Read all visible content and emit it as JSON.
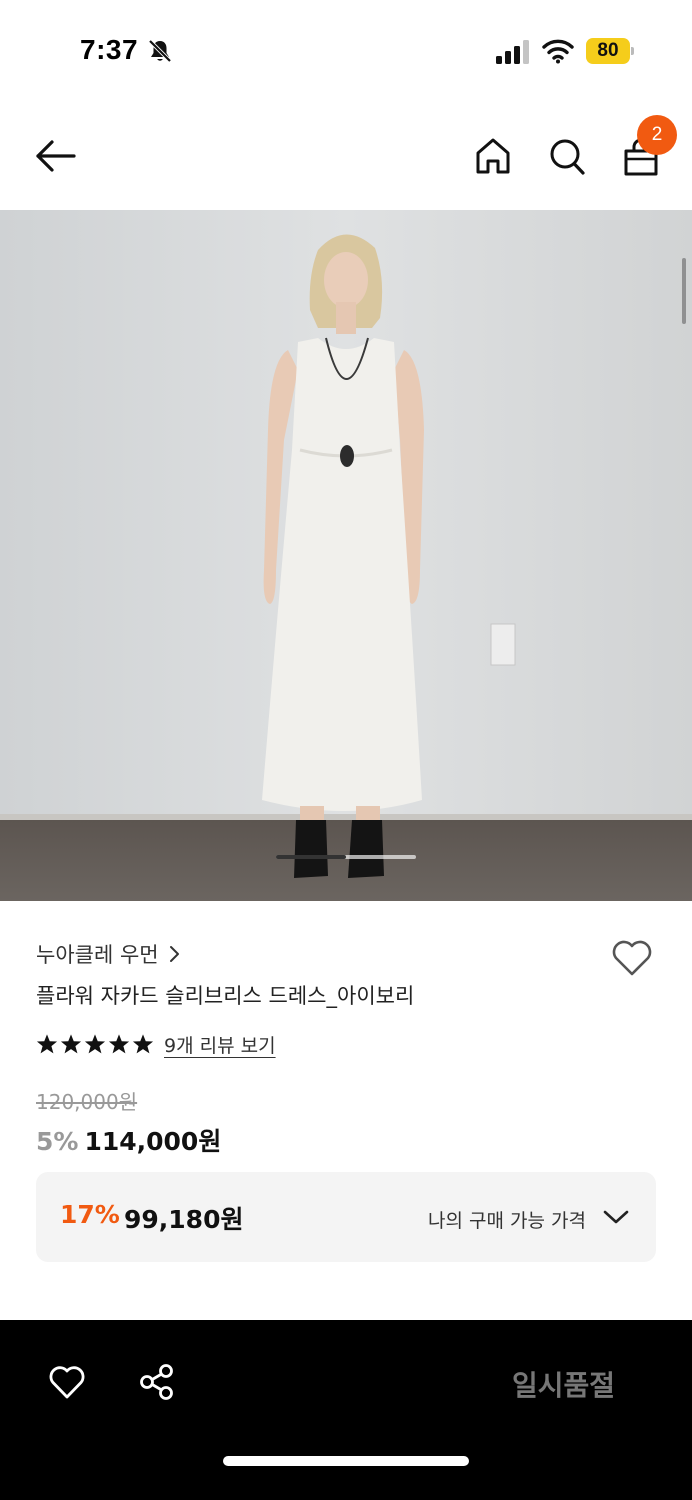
{
  "status_bar": {
    "time": "7:37",
    "battery": "80"
  },
  "header": {
    "cart_count": "2"
  },
  "product": {
    "brand": "누아클레 우먼",
    "title": "플라워 자카드 슬리브리스 드레스_아이보리",
    "rating_stars": 5,
    "review_link": "9개 리뷰 보기",
    "original_price": "120,000원",
    "discount_rate": "5%",
    "sale_price": "114,000원"
  },
  "my_price": {
    "discount_rate": "17%",
    "price": "99,180원",
    "label": "나의 구매 가능 가격"
  },
  "bottom_bar": {
    "soldout_label": "일시품절"
  },
  "colors": {
    "accent": "#f15a11",
    "battery": "#f5cd1b",
    "bottom_bar": "#000000"
  },
  "icons": [
    "bell-slash-icon",
    "signal-icon",
    "wifi-icon",
    "back-arrow-icon",
    "home-icon",
    "search-icon",
    "shopping-bag-icon",
    "heart-icon",
    "star-icon",
    "chevron-right-icon",
    "chevron-down-icon",
    "share-icon"
  ]
}
